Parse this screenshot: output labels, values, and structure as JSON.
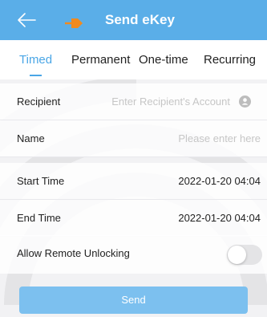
{
  "header": {
    "title": "Send eKey",
    "back_icon": "arrow-left-icon",
    "pin_icon": "pin-icon"
  },
  "tabs": [
    {
      "label": "Timed",
      "active": true
    },
    {
      "label": "Permanent",
      "active": false
    },
    {
      "label": "One-time",
      "active": false
    },
    {
      "label": "Recurring",
      "active": false
    }
  ],
  "form": {
    "recipient": {
      "label": "Recipient",
      "placeholder": "Enter Recipient's Account",
      "icon": "contact-icon"
    },
    "name": {
      "label": "Name",
      "placeholder": "Please enter here"
    },
    "start_time": {
      "label": "Start Time",
      "value": "2022-01-20 04:04"
    },
    "end_time": {
      "label": "End Time",
      "value": "2022-01-20 04:04"
    },
    "remote_unlock": {
      "label": "Allow Remote Unlocking",
      "enabled": false
    }
  },
  "send_label": "Send",
  "colors": {
    "accent": "#5aaee8",
    "button": "#7cc0ef",
    "pin": "#f08a1e"
  }
}
